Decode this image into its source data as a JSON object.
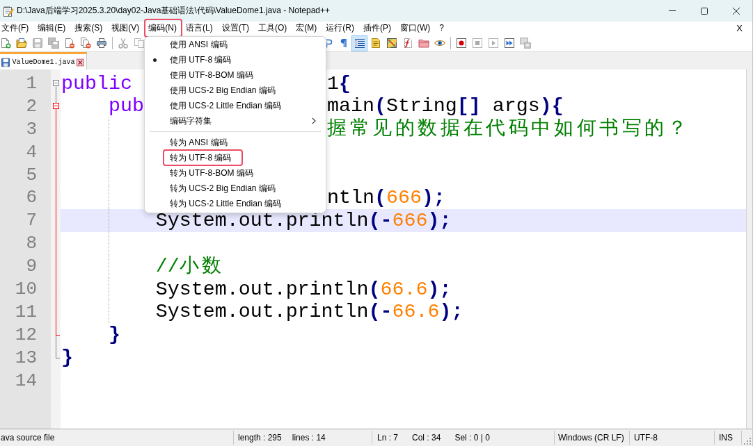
{
  "window": {
    "title": "D:\\Java后端学习2025.3.20\\day02-Java基础语法\\代码\\ValueDome1.java - Notepad++"
  },
  "menu_bar": {
    "items": [
      {
        "label": "文件(F)",
        "annotated": false
      },
      {
        "label": "编辑(E)",
        "annotated": false
      },
      {
        "label": "搜索(S)",
        "annotated": false
      },
      {
        "label": "视图(V)",
        "annotated": false
      },
      {
        "label": "编码(N)",
        "annotated": true,
        "dropdown": {
          "items": [
            {
              "kind": "item",
              "label": "使用 ANSI 编码",
              "checked": false,
              "submenu": false,
              "annotated": false
            },
            {
              "kind": "item",
              "label": "使用 UTF-8 编码",
              "checked": true,
              "submenu": false,
              "annotated": false
            },
            {
              "kind": "item",
              "label": "使用 UTF-8-BOM 编码",
              "checked": false,
              "submenu": false,
              "annotated": false
            },
            {
              "kind": "item",
              "label": "使用 UCS-2 Big Endian 编码",
              "checked": false,
              "submenu": false,
              "annotated": false
            },
            {
              "kind": "item",
              "label": "使用 UCS-2 Little Endian 编码",
              "checked": false,
              "submenu": false,
              "annotated": false
            },
            {
              "kind": "item",
              "label": "编码字符集",
              "checked": false,
              "submenu": true,
              "annotated": false
            },
            {
              "kind": "separator"
            },
            {
              "kind": "item",
              "label": "转为 ANSI 编码",
              "checked": false,
              "submenu": false,
              "annotated": false
            },
            {
              "kind": "item",
              "label": "转为 UTF-8 编码",
              "checked": false,
              "submenu": false,
              "annotated": true
            },
            {
              "kind": "item",
              "label": "转为 UTF-8-BOM 编码",
              "checked": false,
              "submenu": false,
              "annotated": false
            },
            {
              "kind": "item",
              "label": "转为 UCS-2 Big Endian 编码",
              "checked": false,
              "submenu": false,
              "annotated": false
            },
            {
              "kind": "item",
              "label": "转为 UCS-2 Little Endian 编码",
              "checked": false,
              "submenu": false,
              "annotated": false
            }
          ]
        }
      },
      {
        "label": "语言(L)",
        "annotated": false
      },
      {
        "label": "设置(T)",
        "annotated": false
      },
      {
        "label": "工具(O)",
        "annotated": false
      },
      {
        "label": "宏(M)",
        "annotated": false
      },
      {
        "label": "运行(R)",
        "annotated": false
      },
      {
        "label": "插件(P)",
        "annotated": false
      },
      {
        "label": "窗口(W)",
        "annotated": false
      },
      {
        "label": "?",
        "annotated": false
      }
    ],
    "close_label": "X"
  },
  "toolbar": {
    "left_group": [
      {
        "kind": "new",
        "on": false,
        "disabled": false
      },
      {
        "kind": "open",
        "on": false,
        "disabled": false
      },
      {
        "kind": "save",
        "on": false,
        "disabled": true
      },
      {
        "kind": "save_all",
        "on": false,
        "disabled": true
      },
      {
        "kind": "close",
        "on": false,
        "disabled": false
      },
      {
        "kind": "close_all",
        "on": false,
        "disabled": false
      },
      {
        "kind": "print",
        "on": false,
        "disabled": false
      },
      {
        "kind": "separator"
      },
      {
        "kind": "cut",
        "on": false,
        "disabled": true
      },
      {
        "kind": "copy",
        "on": false,
        "disabled": true
      }
    ],
    "right_group": [
      {
        "kind": "wrap",
        "on": false,
        "disabled": false
      },
      {
        "kind": "show_all_chars",
        "on": false,
        "disabled": false
      },
      {
        "kind": "indent_guide",
        "on": true,
        "disabled": false
      },
      {
        "kind": "user_lang",
        "on": false,
        "disabled": false
      },
      {
        "kind": "doc_map",
        "on": false,
        "disabled": false
      },
      {
        "kind": "function_list",
        "on": false,
        "disabled": false
      },
      {
        "kind": "folder_workspace",
        "on": false,
        "disabled": false
      },
      {
        "kind": "monitoring",
        "on": false,
        "disabled": false
      },
      {
        "kind": "separator"
      },
      {
        "kind": "record",
        "on": false,
        "disabled": false
      },
      {
        "kind": "stop",
        "on": false,
        "disabled": true
      },
      {
        "kind": "play",
        "on": false,
        "disabled": true
      },
      {
        "kind": "run_multiple",
        "on": false,
        "disabled": false
      },
      {
        "kind": "save_macro",
        "on": false,
        "disabled": true
      }
    ]
  },
  "tabs": [
    {
      "label": "ValueDome1.java",
      "selected": true,
      "modified": false
    }
  ],
  "editor": {
    "lines": [
      {
        "number": "1",
        "current": false,
        "expanded": true,
        "tokens": [
          {
            "kind": "keyword",
            "text": "public"
          }
        ],
        "right_of_menu": [
          {
            "kind": "plain",
            "text": "1"
          },
          {
            "kind": "operator",
            "text": "{"
          }
        ],
        "children": [
          {
            "number": "2",
            "current": false,
            "expanded": true,
            "tokens": [
              {
                "kind": "keyword",
                "text": "pub"
              }
            ],
            "right_of_menu": [
              {
                "kind": "plain",
                "text": "main"
              },
              {
                "kind": "operator",
                "text": "("
              },
              {
                "kind": "plain",
                "text": "String"
              },
              {
                "kind": "operator",
                "text": "[]"
              },
              {
                "kind": "plain",
                "text": " args"
              },
              {
                "kind": "operator",
                "text": "){"
              }
            ],
            "children": [
              {
                "number": "3",
                "current": false,
                "right_of_menu": [
                  {
                    "kind": "comment",
                    "text": "握常见的数据在代码中如何书写的？"
                  }
                ]
              },
              {
                "number": "4",
                "current": false
              },
              {
                "number": "5",
                "current": false
              },
              {
                "number": "6",
                "current": false,
                "right_of_menu": [
                  {
                    "kind": "plain",
                    "text": "ntln"
                  },
                  {
                    "kind": "operator",
                    "text": "("
                  },
                  {
                    "kind": "number",
                    "text": "666"
                  },
                  {
                    "kind": "operator",
                    "text": ");"
                  }
                ]
              },
              {
                "number": "7",
                "current": true,
                "tokens": [
                  {
                    "kind": "plain",
                    "text": "System.out.println"
                  },
                  {
                    "kind": "operator",
                    "text": "(-"
                  },
                  {
                    "kind": "number",
                    "text": "666"
                  },
                  {
                    "kind": "operator",
                    "text": ");"
                  }
                ]
              },
              {
                "number": "8",
                "current": false
              },
              {
                "number": "9",
                "current": false,
                "tokens": [
                  {
                    "kind": "comment",
                    "text": "//小数"
                  }
                ]
              },
              {
                "number": "10",
                "current": false,
                "tokens": [
                  {
                    "kind": "plain",
                    "text": "System.out.println"
                  },
                  {
                    "kind": "operator",
                    "text": "("
                  },
                  {
                    "kind": "number",
                    "text": "66.6"
                  },
                  {
                    "kind": "operator",
                    "text": ");"
                  }
                ]
              },
              {
                "number": "11",
                "current": false,
                "tokens": [
                  {
                    "kind": "plain",
                    "text": "System.out.println"
                  },
                  {
                    "kind": "operator",
                    "text": "(-"
                  },
                  {
                    "kind": "number",
                    "text": "66.6"
                  },
                  {
                    "kind": "operator",
                    "text": ");"
                  }
                ]
              }
            ],
            "closing": {
              "number": "12",
              "current": false,
              "tokens": [
                {
                  "kind": "operator",
                  "text": "}"
                }
              ]
            }
          }
        ],
        "closing": {
          "number": "13",
          "current": false,
          "tokens": [
            {
              "kind": "operator",
              "text": "}"
            }
          ]
        }
      },
      {
        "number": "14",
        "current": false
      }
    ]
  },
  "status_bar": {
    "file_type": "ava source file",
    "doc_stats": [
      "length : 295",
      "lines : 14"
    ],
    "position": [
      "Ln : 7",
      "Col : 34",
      "Sel : 0 | 0"
    ],
    "eol": "Windows (CR LF)",
    "encoding": "UTF-8",
    "mode": "INS"
  }
}
